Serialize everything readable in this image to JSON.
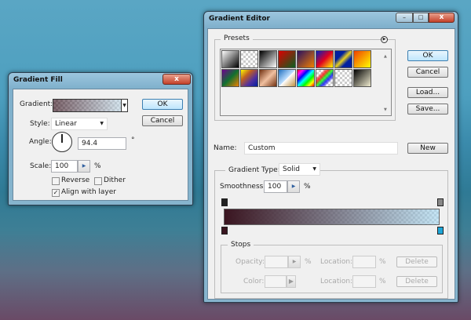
{
  "gradient_fill": {
    "title": "Gradient Fill",
    "gradient_label": "Gradient:",
    "style_label": "Style:",
    "style_value": "Linear",
    "angle_label": "Angle:",
    "angle_value": "94.4",
    "degree_symbol": "°",
    "scale_label": "Scale:",
    "scale_value": "100",
    "percent": "%",
    "reverse_label": "Reverse",
    "reverse_checked": false,
    "dither_label": "Dither",
    "dither_checked": false,
    "align_label": "Align with layer",
    "align_checked": true,
    "ok": "OK",
    "cancel": "Cancel",
    "close": "x"
  },
  "gradient_editor": {
    "title": "Gradient Editor",
    "presets_label": "Presets",
    "ok": "OK",
    "cancel": "Cancel",
    "load": "Load...",
    "save": "Save...",
    "name_label": "Name:",
    "name_value": "Custom",
    "new": "New",
    "gradient_type_label": "Gradient Type:",
    "gradient_type_value": "Solid",
    "smoothness_label": "Smoothness:",
    "smoothness_value": "100",
    "percent": "%",
    "stops_label": "Stops",
    "opacity_label": "Opacity:",
    "color_label": "Color:",
    "location_label": "Location:",
    "delete": "Delete",
    "colors": {
      "start": "#3a1520",
      "end": "#a8d8f0",
      "end_stop": "#1ea6d8"
    }
  }
}
